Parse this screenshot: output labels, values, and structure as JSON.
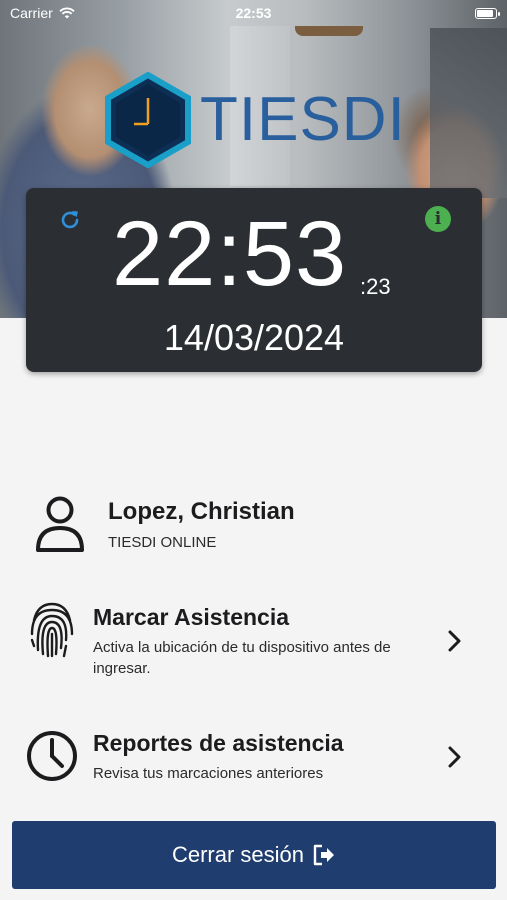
{
  "status_bar": {
    "carrier": "Carrier",
    "time": "22:53"
  },
  "logo": {
    "text": "TIESDI"
  },
  "clock": {
    "time": "22:53",
    "seconds": ":23",
    "date": "14/03/2024"
  },
  "user": {
    "name": "Lopez, Christian",
    "company": "TIESDI ONLINE"
  },
  "menu": [
    {
      "title": "Marcar Asistencia",
      "subtitle": "Activa la ubicación de tu dispositivo antes de ingresar.",
      "icon": "fingerprint-icon"
    },
    {
      "title": "Reportes de asistencia",
      "subtitle": "Revisa tus marcaciones anteriores",
      "icon": "clock-icon"
    }
  ],
  "logout": {
    "label": "Cerrar sesión"
  },
  "colors": {
    "accent_blue": "#1f3d6e",
    "refresh_blue": "#2f8fd8",
    "info_green": "#4caf50",
    "card_bg": "#2b2e33",
    "logo_blue": "#2a5f9e"
  }
}
